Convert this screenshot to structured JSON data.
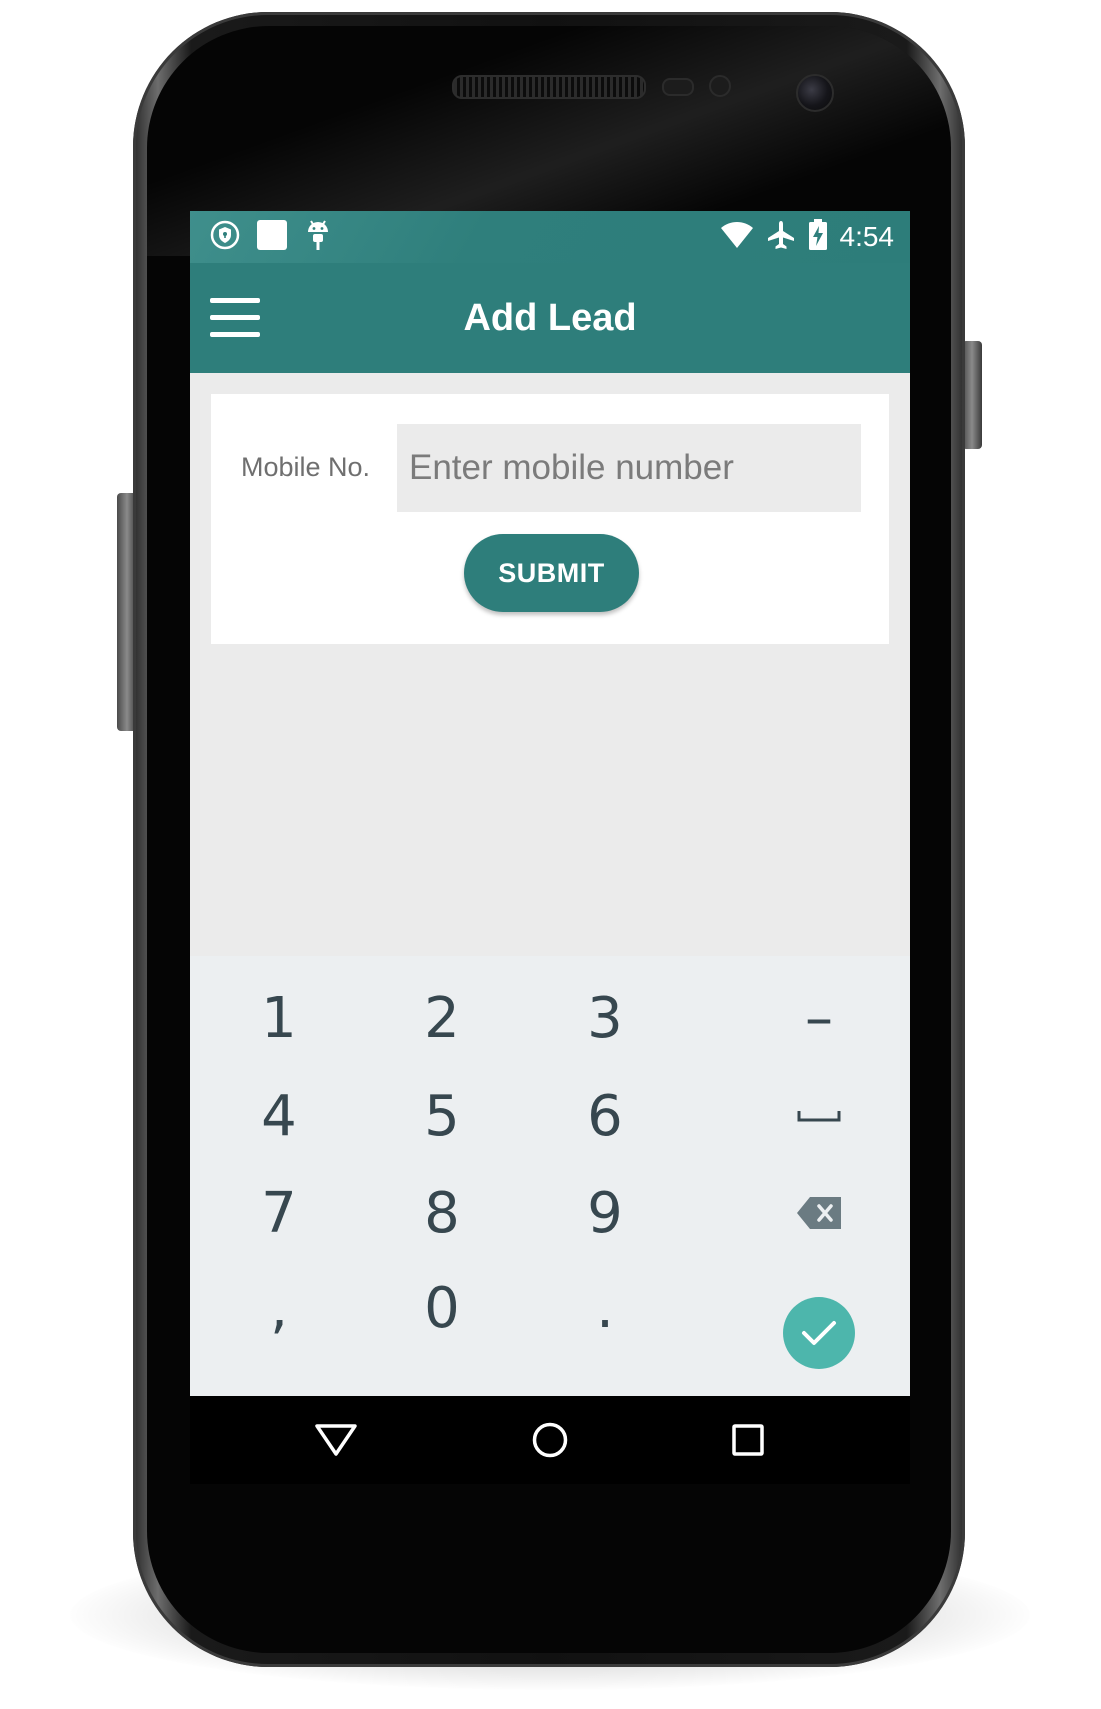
{
  "status_bar": {
    "time": "4:54",
    "left_icons": [
      "vpn-shield-icon",
      "notification-square-icon",
      "android-debug-icon"
    ],
    "right_icons": [
      "wifi-icon",
      "airplane-mode-icon",
      "battery-charging-icon"
    ]
  },
  "app_bar": {
    "title": "Add Lead",
    "menu_icon": "hamburger-menu-icon",
    "color": "#2e7e7b"
  },
  "form": {
    "mobile_label": "Mobile No.",
    "mobile_placeholder": "Enter mobile number",
    "mobile_value": "",
    "submit_label": "SUBMIT"
  },
  "keypad": {
    "rows": [
      [
        "1",
        "2",
        "3",
        "–"
      ],
      [
        "4",
        "5",
        "6",
        "space"
      ],
      [
        "7",
        "8",
        "9",
        "backspace"
      ],
      [
        ",",
        "0",
        ".",
        "done"
      ]
    ],
    "done_color": "#4db6ac"
  },
  "nav_bar": {
    "buttons": [
      "back-icon",
      "home-icon",
      "recents-icon"
    ]
  }
}
